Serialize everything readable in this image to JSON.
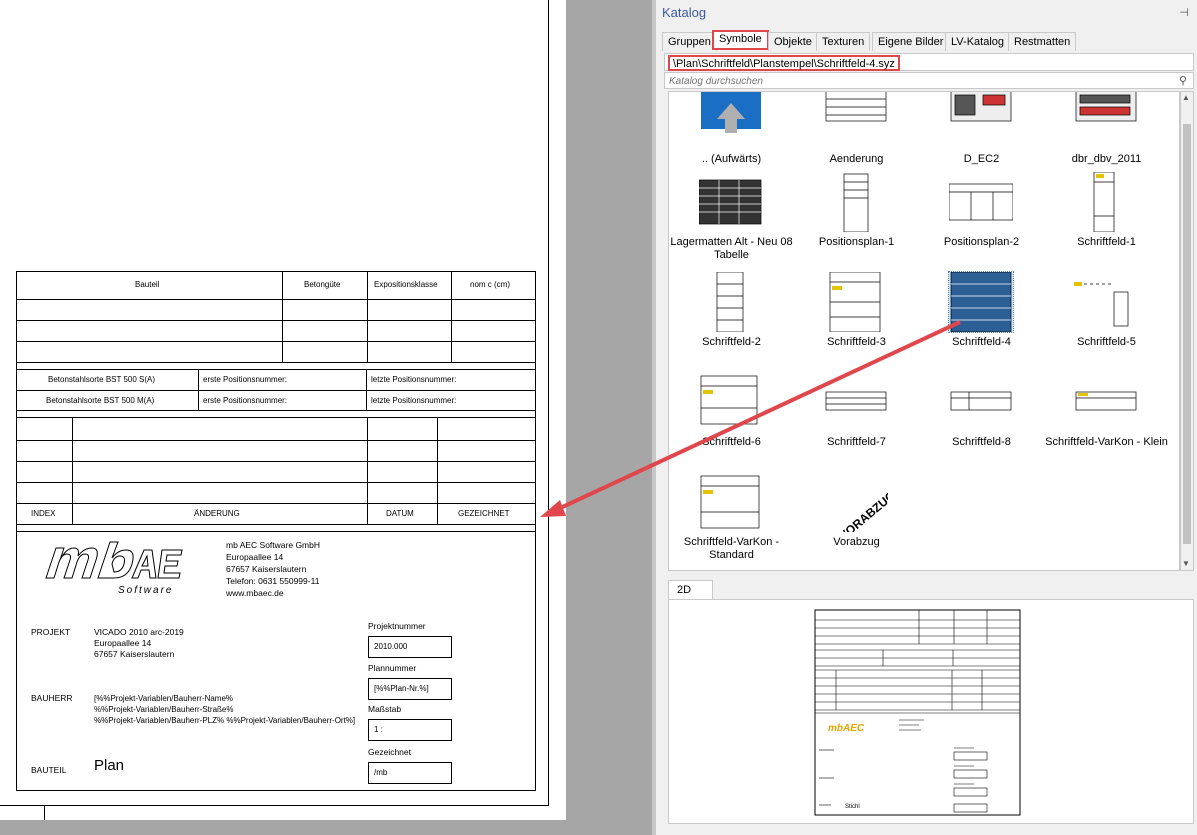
{
  "drawing": {
    "header": {
      "bauteil": "Bauteil",
      "betonguete": "Betongüte",
      "exposition": "Expositionsklasse",
      "nomc": "nom c (cm)"
    },
    "steel": [
      {
        "sorte": "Betonstahlsorte BST 500 S(A)",
        "erste": "erste Positionsnummer:",
        "letzte": "letzte Positionsnummer:"
      },
      {
        "sorte": "Betonstahlsorte BST 500 M(A)",
        "erste": "erste Positionsnummer:",
        "letzte": "letzte Positionsnummer:"
      }
    ],
    "revision": {
      "index": "INDEX",
      "aenderung": "ÄNDERUNG",
      "datum": "DATUM",
      "gezeichnet": "GEZEICHNET"
    },
    "logo": {
      "main": "mbAEC",
      "sub": "Software"
    },
    "company": [
      "mb AEC Software GmbH",
      "Europaallee 14",
      "67657 Kaiserslautern",
      "Telefon: 0631 550999-11",
      "www.mbaec.de"
    ],
    "projekt": {
      "label": "PROJEKT",
      "lines": [
        "VICADO 2010 arc-2019",
        "Europaallee 14",
        "67657 Kaiserslautern"
      ]
    },
    "bauherr": {
      "label": "BAUHERR",
      "lines": [
        "[%%Projekt-Variablen/Bauherr-Name%",
        "%%Projekt-Variablen/Bauherr-Straße%",
        "%%Projekt-Variablen/Bauherr-PLZ% %%Projekt-Variablen/Bauherr-Ort%]"
      ]
    },
    "bauteil": {
      "label": "BAUTEIL",
      "value": "Plan"
    },
    "fields": {
      "projektnummer_label": "Projektnummer",
      "projektnummer": "2010.000",
      "plannummer_label": "Plannummer",
      "plannummer": "[%%Plan-Nr.%]",
      "massstab_label": "Maßstab",
      "massstab": "1 :",
      "gezeichnet_label": "Gezeichnet",
      "gezeichnet": "/mb"
    }
  },
  "catalog": {
    "title": "Katalog",
    "tabs": [
      "Gruppen",
      "Symbole",
      "Objekte",
      "Texturen",
      "Eigene Bilder",
      "LV-Katalog",
      "Restmatten"
    ],
    "active_tab": "Symbole",
    "path": "\\Plan\\Schriftfeld\\Planstempel\\Schriftfeld-4.syz",
    "search_placeholder": "Katalog durchsuchen",
    "items": [
      {
        "label": ".. (Aufwärts)",
        "icon": "folder-up-icon"
      },
      {
        "label": "Aenderung",
        "icon": "table-thumbnail"
      },
      {
        "label": "D_EC2",
        "icon": "drawing-thumbnail"
      },
      {
        "label": "dbr_dbv_2011",
        "icon": "drawing-thumbnail"
      },
      {
        "label": "Lagermatten Alt - Neu 08 Tabelle",
        "icon": "table-thumbnail"
      },
      {
        "label": "Positionsplan-1",
        "icon": "form-thumbnail"
      },
      {
        "label": "Positionsplan-2",
        "icon": "form-thumbnail"
      },
      {
        "label": "Schriftfeld-1",
        "icon": "form-thumbnail"
      },
      {
        "label": "Schriftfeld-2",
        "icon": "form-thumbnail"
      },
      {
        "label": "Schriftfeld-3",
        "icon": "form-thumbnail"
      },
      {
        "label": "Schriftfeld-4",
        "icon": "form-thumbnail",
        "selected": true
      },
      {
        "label": "Schriftfeld-5",
        "icon": "form-thumbnail"
      },
      {
        "label": "Schriftfeld-6",
        "icon": "form-thumbnail"
      },
      {
        "label": "Schriftfeld-7",
        "icon": "form-thumbnail"
      },
      {
        "label": "Schriftfeld-8",
        "icon": "form-thumbnail"
      },
      {
        "label": "Schriftfeld-VarKon - Klein",
        "icon": "form-thumbnail"
      },
      {
        "label": "Schriftfeld-VarKon - Standard",
        "icon": "form-thumbnail"
      },
      {
        "label": "Vorabzug",
        "icon": "stamp-thumbnail",
        "stamp_text": "VORABZUG"
      }
    ],
    "preview_tab": "2D",
    "preview": {
      "logo": "mbAEC",
      "stamp": "Stichl"
    }
  },
  "colors": {
    "highlight": "#e0474c",
    "arrow": "#e0474c",
    "folder_blue": "#1a6fc4",
    "title_blue": "#3c5a99"
  }
}
